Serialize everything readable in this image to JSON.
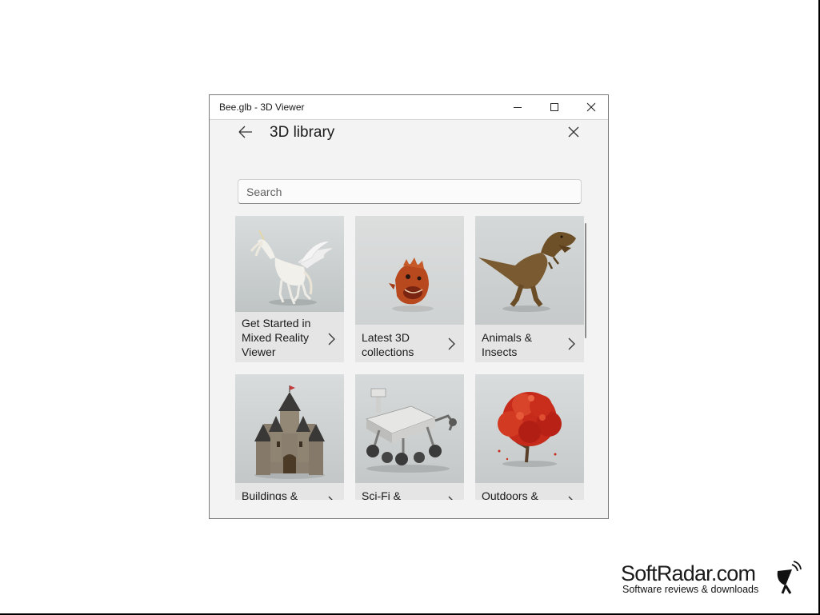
{
  "window": {
    "title": "Bee.glb - 3D Viewer"
  },
  "library": {
    "title": "3D library",
    "search_placeholder": "Search",
    "categories": [
      {
        "label": "Get Started in Mixed Reality Viewer"
      },
      {
        "label": "Latest 3D collections"
      },
      {
        "label": "Animals & Insects"
      },
      {
        "label": "Buildings &"
      },
      {
        "label": "Sci-Fi &"
      },
      {
        "label": "Outdoors &"
      }
    ]
  },
  "watermark": {
    "name": "SoftRadar.com",
    "tagline": "Software reviews & downloads"
  },
  "colors": {
    "window_bg": "#f3f3f3",
    "card_bg": "#e5e5e5",
    "titlebar_bg": "#ffffff"
  }
}
